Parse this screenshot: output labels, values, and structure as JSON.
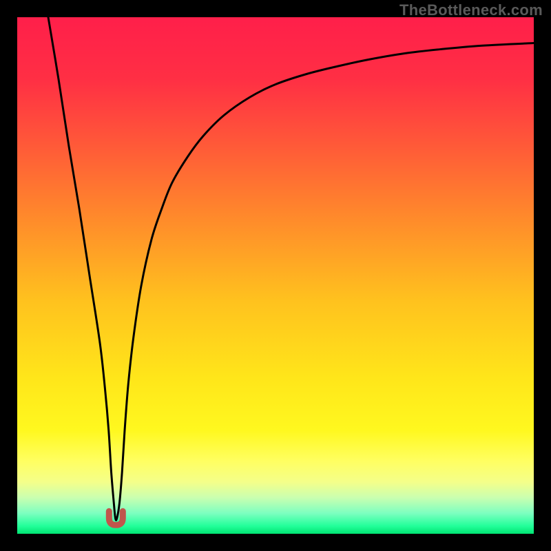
{
  "watermark": "TheBottleneck.com",
  "chart_data": {
    "type": "line",
    "title": "",
    "xlabel": "",
    "ylabel": "",
    "xlim": [
      0,
      100
    ],
    "ylim": [
      0,
      100
    ],
    "series": [
      {
        "name": "bottleneck-curve",
        "x": [
          6,
          8,
          10,
          12,
          14,
          16,
          17,
          17.7,
          18.2,
          18.7,
          19.0,
          19.3,
          19.8,
          20.3,
          20.8,
          21.5,
          22.5,
          24,
          26,
          28,
          30,
          33,
          36,
          40,
          45,
          50,
          56,
          62,
          68,
          75,
          82,
          90,
          100
        ],
        "values": [
          100,
          88,
          75,
          63,
          50,
          37,
          28,
          20,
          12,
          6,
          3,
          3,
          6,
          12,
          20,
          29,
          38,
          48,
          57,
          63,
          68,
          73,
          77,
          81,
          84.5,
          87,
          89,
          90.5,
          91.8,
          93,
          93.8,
          94.5,
          95
        ]
      }
    ],
    "marker": {
      "x": 19.1,
      "y": 2.5,
      "color": "#c0564c"
    },
    "background_gradient": {
      "stops": [
        {
          "offset": 0.0,
          "color": "#ff1f4a"
        },
        {
          "offset": 0.12,
          "color": "#ff2f44"
        },
        {
          "offset": 0.25,
          "color": "#ff5a38"
        },
        {
          "offset": 0.4,
          "color": "#ff8e2a"
        },
        {
          "offset": 0.55,
          "color": "#ffc21e"
        },
        {
          "offset": 0.7,
          "color": "#ffe61a"
        },
        {
          "offset": 0.8,
          "color": "#fff81f"
        },
        {
          "offset": 0.86,
          "color": "#ffff62"
        },
        {
          "offset": 0.9,
          "color": "#f4ff8a"
        },
        {
          "offset": 0.93,
          "color": "#caffb0"
        },
        {
          "offset": 0.96,
          "color": "#7dffc0"
        },
        {
          "offset": 0.985,
          "color": "#22ff9a"
        },
        {
          "offset": 1.0,
          "color": "#00e472"
        }
      ]
    }
  }
}
